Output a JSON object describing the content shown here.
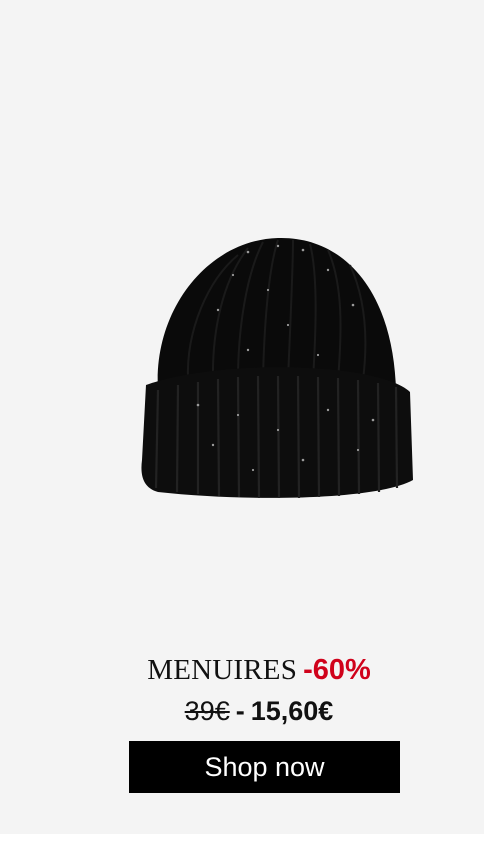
{
  "product": {
    "name": "MENUIRES",
    "discount": "-60%",
    "old_price": "39€",
    "separator": "-",
    "new_price": "15,60€"
  },
  "cta": {
    "label": "Shop now"
  },
  "colors": {
    "background": "#f4f4f4",
    "discount": "#d0021b",
    "button": "#000000",
    "button_text": "#ffffff"
  }
}
